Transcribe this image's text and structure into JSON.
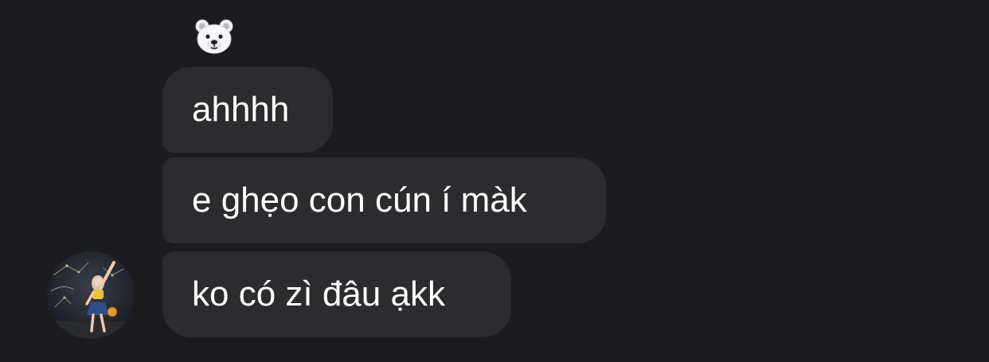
{
  "conversation": {
    "reaction": {
      "icon": "polar-bear-face-icon",
      "emoji": "🐻‍❄️"
    },
    "messages": [
      {
        "text": "ahhhh"
      },
      {
        "text": "e ghẹo con cún í màk"
      },
      {
        "text": "ko có zì đâu ạkk"
      }
    ],
    "sender": {
      "avatar": "avatar-photo"
    }
  },
  "colors": {
    "background": "#1c1c1e",
    "bubble": "#2c2c2e",
    "text": "#ffffff"
  }
}
